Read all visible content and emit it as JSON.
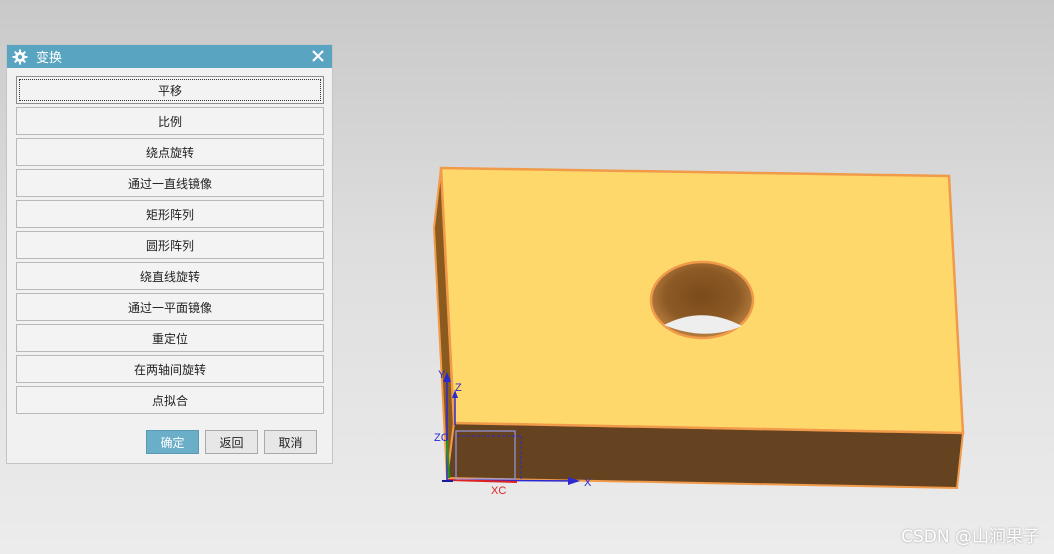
{
  "dialog": {
    "title": "变换",
    "icons": {
      "title": "gear-icon",
      "close": "close-icon"
    },
    "buttons": [
      "平移",
      "比例",
      "绕点旋转",
      "通过一直线镜像",
      "矩形阵列",
      "圆形阵列",
      "绕直线旋转",
      "通过一平面镜像",
      "重定位",
      "在两轴间旋转",
      "点拟合"
    ],
    "ok_label": "确定",
    "back_label": "返回",
    "cancel_label": "取消",
    "accent": "#59a5c1"
  },
  "viewport": {
    "axis_labels": {
      "y": "Y",
      "z": "Z",
      "zc": "ZC",
      "xc": "XC",
      "x": "X"
    },
    "part_colors": {
      "top": "#fed86a",
      "front": "#654321",
      "edge": "#f09a4a"
    }
  },
  "watermark": "CSDN @山涧果子"
}
